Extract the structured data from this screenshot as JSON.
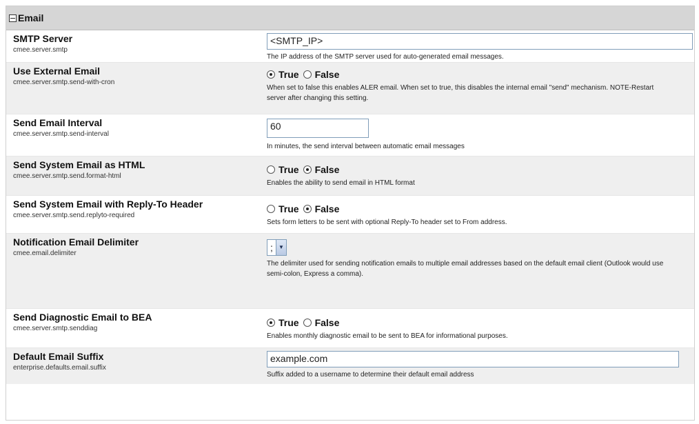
{
  "section": {
    "title": "Email"
  },
  "settings": [
    {
      "name": "SMTP Server",
      "key": "cmee.server.smtp",
      "value": "<SMTP_IP>",
      "description": "The IP address of the SMTP server used for auto-generated email messages."
    },
    {
      "name": "Use External Email",
      "key": "cmee.server.smtp.send-with-cron",
      "true_label": "True",
      "false_label": "False",
      "selected": "True",
      "description": "When set to false this enables ALER email.  When set to true, this disables the internal email \"send\" mechanism. NOTE-Restart server after changing this setting."
    },
    {
      "name": "Send Email Interval",
      "key": "cmee.server.smtp.send-interval",
      "value": "60",
      "description": "In minutes, the send interval between automatic email messages"
    },
    {
      "name": "Send System Email as HTML",
      "key": "cmee.server.smtp.send.format-html",
      "true_label": "True",
      "false_label": "False",
      "selected": "False",
      "description": "Enables the ability to send email in HTML format"
    },
    {
      "name": "Send System Email with Reply-To Header",
      "key": "cmee.server.smtp.send.replyto-required",
      "true_label": "True",
      "false_label": "False",
      "selected": "False",
      "description": "Sets form letters to be sent with optional Reply-To header set to From address."
    },
    {
      "name": "Notification Email Delimiter",
      "key": "cmee.email.delimiter",
      "value": ";",
      "description": "The delimiter used for sending notification emails to multiple email addresses based on the default email client (Outlook would use semi-colon, Express a comma)."
    },
    {
      "name": "Send Diagnostic Email to BEA",
      "key": "cmee.server.smtp.senddiag",
      "true_label": "True",
      "false_label": "False",
      "selected": "True",
      "description": "Enables monthly diagnostic email to be sent to BEA for informational purposes."
    },
    {
      "name": "Default Email Suffix",
      "key": "enterprise.defaults.email.suffix",
      "value": "example.com",
      "description": "Suffix added to a username to determine their default email address"
    }
  ]
}
